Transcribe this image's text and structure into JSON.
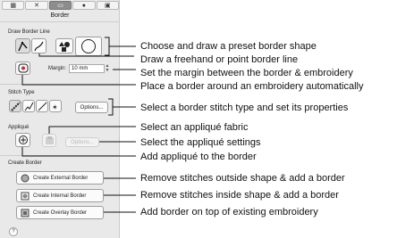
{
  "panel": {
    "title": "Border",
    "tabs": [
      "pattern-icon",
      "stitch-icon",
      "border-icon",
      "applique-icon",
      "frame-icon"
    ],
    "sections": {
      "draw_border_line": "Draw Border Line",
      "margin_label": "Margin:",
      "margin_value": "10 mm",
      "stitch_type": "Stitch Type",
      "options_label": "Options...",
      "applique": "Appliqué",
      "applique_options_label": "Options...",
      "create_border": "Create Border",
      "create_external": "Create External Border",
      "create_internal": "Create Internal Border",
      "create_overlay": "Create Overlay Border",
      "help": "?"
    }
  },
  "annotations": [
    "Choose and draw a preset border shape",
    "Draw a freehand or point border line",
    "Set the margin between the border & embroidery",
    "Place a border around an embroidery automatically",
    "Select a border stitch type and set its properties",
    "Select an appliqué fabric",
    "Select the appliqué settings",
    "Add appliqué to the border",
    "Remove stitches outside shape & add a border",
    "Remove stitches inside shape & add a border",
    "Add border on top of existing embroidery"
  ],
  "colors": {
    "panel_bg": "#e9e9e9",
    "line": "#111111"
  }
}
